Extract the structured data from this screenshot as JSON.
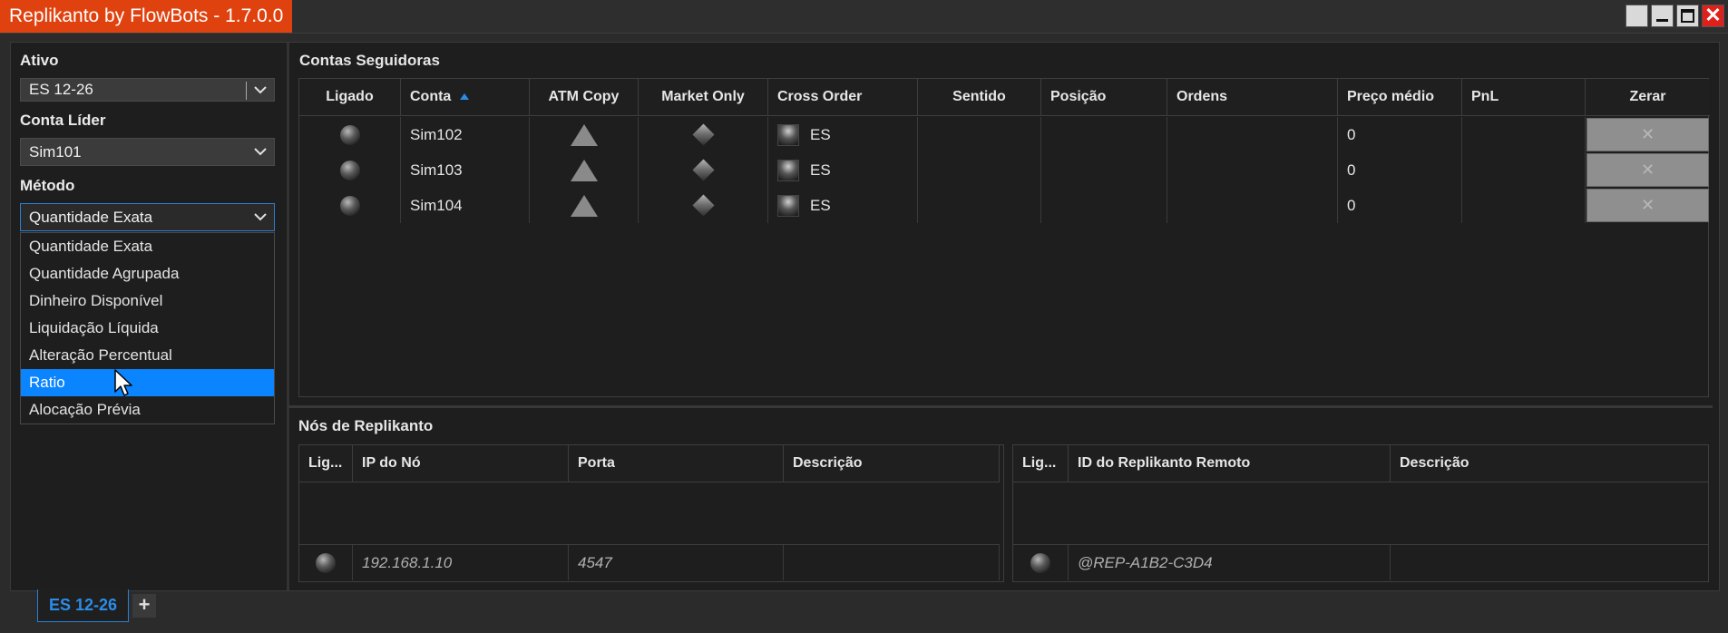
{
  "window": {
    "title": "Replikanto by FlowBots - 1.7.0.0",
    "close_glyph": "✕"
  },
  "left": {
    "ativo_label": "Ativo",
    "ativo_value": "ES 12-26",
    "conta_lider_label": "Conta Líder",
    "conta_lider_value": "Sim101",
    "metodo_label": "Método",
    "metodo_value": "Quantidade Exata",
    "metodo_options": [
      "Quantidade Exata",
      "Quantidade Agrupada",
      "Dinheiro Disponível",
      "Liquidação Líquida",
      "Alteração Percentual",
      "Ratio",
      "Alocação Prévia"
    ],
    "metodo_highlighted": "Ratio"
  },
  "followers": {
    "title": "Contas Seguidoras",
    "columns": [
      "Ligado",
      "Conta",
      "ATM Copy",
      "Market Only",
      "Cross Order",
      "Sentido",
      "Posição",
      "Ordens",
      "Preço médio",
      "PnL",
      "Zerar"
    ],
    "sorted_column": "Conta",
    "rows": [
      {
        "conta": "Sim102",
        "cross": "ES",
        "sentido": "",
        "posicao": "",
        "ordens": "",
        "preco": "0",
        "pnl": "",
        "zerar": "✕"
      },
      {
        "conta": "Sim103",
        "cross": "ES",
        "sentido": "",
        "posicao": "",
        "ordens": "",
        "preco": "0",
        "pnl": "",
        "zerar": "✕"
      },
      {
        "conta": "Sim104",
        "cross": "ES",
        "sentido": "",
        "posicao": "",
        "ordens": "",
        "preco": "0",
        "pnl": "",
        "zerar": "✕"
      }
    ]
  },
  "nodes": {
    "title": "Nós de Replikanto",
    "local_columns": [
      "Lig...",
      "IP do Nó",
      "Porta",
      "Descrição"
    ],
    "local_new_row": {
      "ip": "192.168.1.10",
      "porta": "4547",
      "descricao": ""
    },
    "remote_columns": [
      "Lig...",
      "ID do Replikanto Remoto",
      "Descrição"
    ],
    "remote_new_row": {
      "id": "@REP-A1B2-C3D4",
      "descricao": ""
    }
  },
  "tabs": {
    "items": [
      "ES 12-26"
    ],
    "add_label": "+"
  },
  "colors": {
    "accent": "#0a84ff",
    "title_bg": "#e0420f",
    "close_bg": "#e0201a"
  }
}
